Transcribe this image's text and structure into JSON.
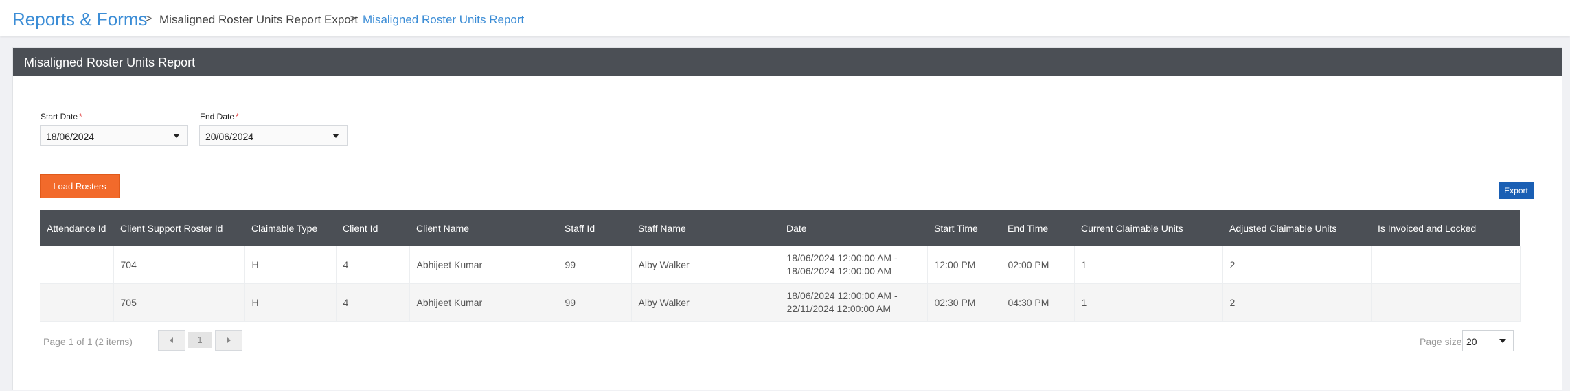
{
  "breadcrumb": {
    "root": "Reports & Forms",
    "items": [
      "Misaligned Roster Units Report Export",
      "Misaligned Roster Units Report"
    ],
    "separator": ">"
  },
  "panel": {
    "title": "Misaligned Roster Units Report"
  },
  "filters": {
    "start_label": "Start Date",
    "start_value": "18/06/2024",
    "end_label": "End Date",
    "end_value": "20/06/2024",
    "required_mark": "*"
  },
  "buttons": {
    "load": "Load Rosters",
    "export": "Export"
  },
  "table": {
    "columns": [
      "Attendance Id",
      "Client Support Roster Id",
      "Claimable Type",
      "Client Id",
      "Client Name",
      "Staff Id",
      "Staff Name",
      "Date",
      "Start Time",
      "End Time",
      "Current Claimable Units",
      "Adjusted Claimable Units",
      "Is Invoiced and Locked"
    ],
    "rows": [
      [
        "",
        "704",
        "H",
        "4",
        "Abhijeet Kumar",
        "99",
        "Alby Walker",
        "18/06/2024 12:00:00 AM - 18/06/2024 12:00:00 AM",
        "12:00 PM",
        "02:00 PM",
        "1",
        "2",
        ""
      ],
      [
        "",
        "705",
        "H",
        "4",
        "Abhijeet Kumar",
        "99",
        "Alby Walker",
        "18/06/2024 12:00:00 AM - 22/11/2024 12:00:00 AM",
        "02:30 PM",
        "04:30 PM",
        "1",
        "2",
        ""
      ]
    ]
  },
  "pager": {
    "info": "Page 1 of 1 (2 items)",
    "current_page": "1",
    "page_size_label": "Page size:",
    "page_size": "20"
  },
  "colors": {
    "accent_blue": "#3c8dd6",
    "header_dark": "#4b4f55",
    "load_button": "#f26a2b",
    "export_button": "#1a5fb4"
  }
}
